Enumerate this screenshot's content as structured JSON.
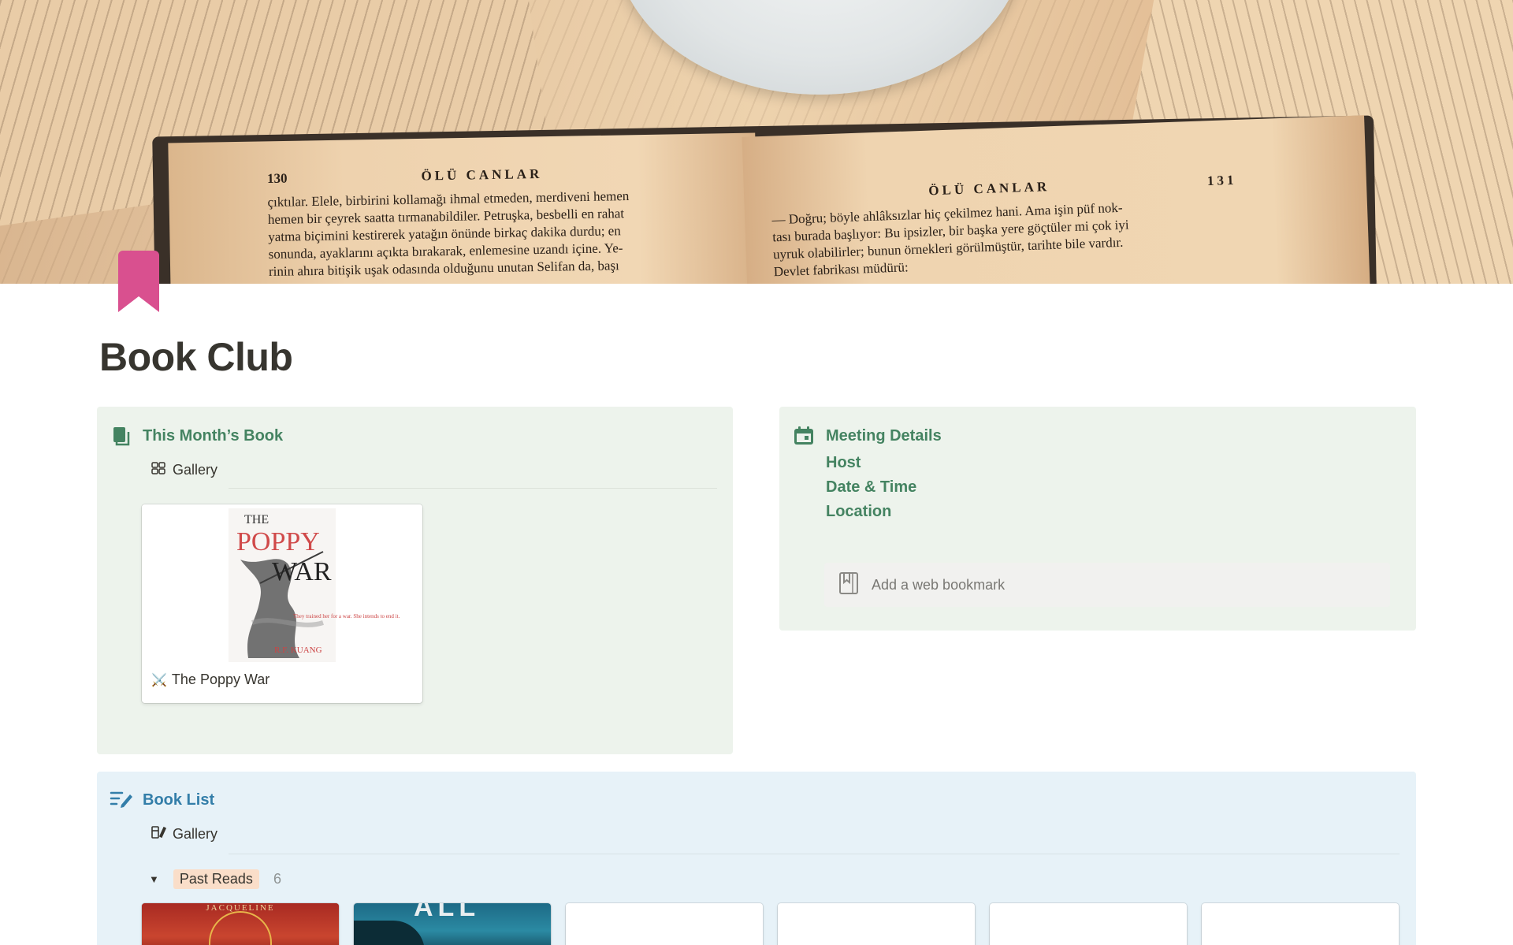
{
  "cover": {
    "left_page": {
      "number": "130",
      "running_head": "ÖLÜ CANLAR",
      "lines": [
        "çıktılar. Elele, birbirini kollamağı ihmal etmeden, merdiveni hemen",
        "hemen bir çeyrek saatta tırmanabildiler. Petruşka, besbelli en rahat",
        "yatma biçimini kestirerek yatağın önünde birkaç dakika durdu; en",
        "sonunda, ayaklarını açıkta bırakarak, enlemesine uzandı içine. Ye-",
        "rinin ahıra bitişik uşak odasında olduğunu unutan Selifan da, başı"
      ]
    },
    "right_page": {
      "number": "131",
      "running_head": "ÖLÜ CANLAR",
      "lines": [
        "— Doğru; böyle ahlâksızlar hiç çekilmez hani. Ama işin püf nok-",
        "tası burada başlıyor: Bu ipsizler, bir başka yere göçtüler mi çok iyi",
        "uyruk olabilirler; bunun örnekleri görülmüştür, tarihte bile vardır.",
        "Devlet fabrikası müdürü:"
      ]
    }
  },
  "page": {
    "icon": "bookmark-icon",
    "title": "Book Club"
  },
  "this_month": {
    "icon": "books-icon",
    "heading": "This Month’s Book",
    "view_label": "Gallery",
    "view_icon": "gallery-grid-icon",
    "card": {
      "emoji": "⚔️",
      "title": "The Poppy War",
      "cover": {
        "top_word": "THE",
        "title_line_1": "POPPY",
        "title_line_2": "WAR",
        "blurb": "They trained her for a war. She intends to end it.",
        "author": "R.F. KUANG"
      }
    }
  },
  "meeting": {
    "icon": "calendar-icon",
    "heading": "Meeting Details",
    "links": [
      "Host",
      "Date & Time",
      "Location"
    ],
    "bookmark_placeholder": "Add a web bookmark",
    "bookmark_icon": "web-bookmark-icon"
  },
  "book_list": {
    "icon": "list-edit-icon",
    "heading": "Book List",
    "view_label": "Gallery",
    "view_icon": "book-gallery-icon",
    "group": {
      "label": "Past Reads",
      "count": "6",
      "toggle_icon": "triangle-down-icon"
    },
    "cards": [
      {
        "cover_text": "JACQUELINE"
      },
      {
        "cover_text": "ALL"
      },
      {
        "cover_text": ""
      },
      {
        "cover_text": ""
      },
      {
        "cover_text": ""
      },
      {
        "cover_text": ""
      }
    ]
  },
  "colors": {
    "green_callout_bg": "#edf3ec",
    "blue_callout_bg": "#e7f2f8",
    "green_text": "#448361",
    "blue_text": "#337ea9",
    "bookmark_pink": "#d9508f",
    "past_reads_tag": "#fadec9"
  }
}
